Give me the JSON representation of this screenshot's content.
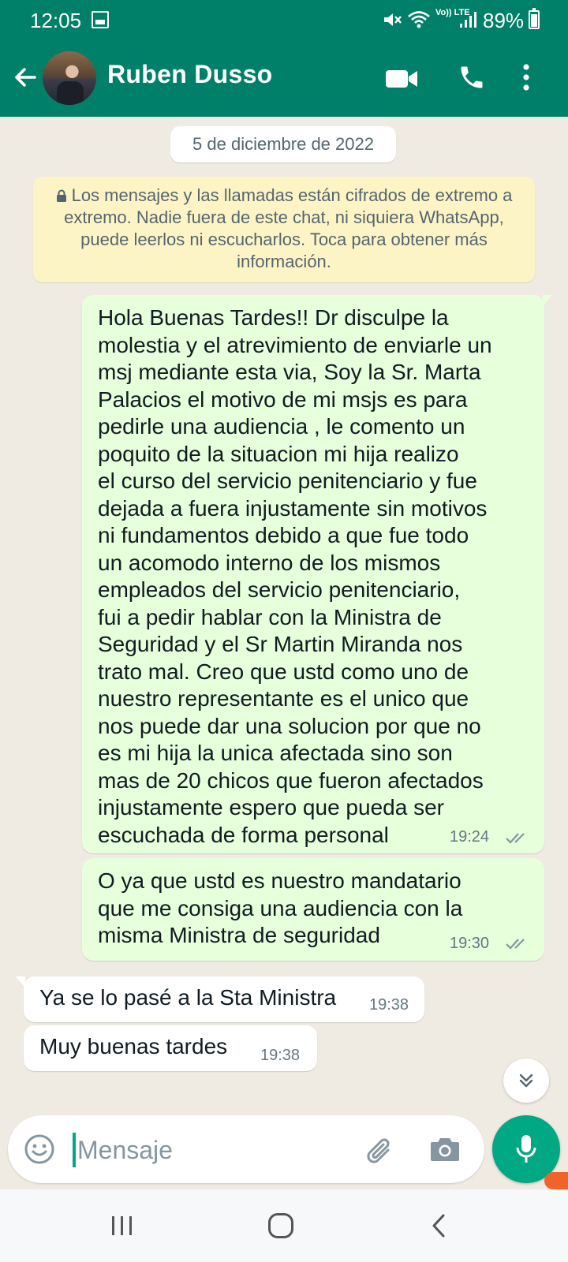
{
  "status_bar": {
    "time": "12:05",
    "network_label": "Vo)) LTE",
    "battery": "89%",
    "battery_level": 0.89
  },
  "header": {
    "contact_name": "Ruben Dusso",
    "back_icon": "arrow-left-icon",
    "video_icon": "video-camera-icon",
    "call_icon": "phone-icon",
    "menu_icon": "more-vert-icon"
  },
  "chat": {
    "date_chip": "5 de diciembre de 2022",
    "encryption_notice": "Los mensajes y las llamadas están cifrados de extremo a extremo. Nadie fuera de este chat, ni siquiera WhatsApp, puede leerlos ni escucharlos. Toca para obtener más información.",
    "messages": [
      {
        "direction": "outgoing",
        "text": "Hola Buenas Tardes!! Dr disculpe la\nmolestia y el atrevimiento de enviarle un\nmsj mediante esta via, Soy la Sr. Marta\nPalacios el motivo de mi msjs es para\npedirle una audiencia , le comento un\npoquito de la situacion mi hija realizo\nel curso del servicio penitenciario y fue\ndejada a fuera injustamente sin motivos\nni fundamentos debido a que fue todo\nun acomodo interno de los mismos\nempleados del servicio penitenciario,\nfui a pedir hablar con la Ministra de\nSeguridad  y el Sr Martin Miranda nos\ntrato mal. Creo que ustd como uno de\nnuestro representante es el unico que\nnos puede dar una solucion por que no\nes mi hija la unica afectada sino son\nmas de 20 chicos que fueron afectados\ninjustamente espero que pueda ser\nescuchada de forma personal",
        "time": "19:24",
        "status": "delivered"
      },
      {
        "direction": "outgoing",
        "text": "O ya que ustd es nuestro mandatario\nque me consiga una audiencia con la\nmisma  Ministra de seguridad",
        "time": "19:30",
        "status": "delivered"
      },
      {
        "direction": "incoming",
        "text": "Ya se lo pasé a la Sta Ministra",
        "time": "19:38"
      },
      {
        "direction": "incoming",
        "text": "Muy buenas tardes",
        "time": "19:38"
      }
    ]
  },
  "composer": {
    "placeholder": "Mensaje",
    "emoji_icon": "emoji-icon",
    "attach_icon": "paperclip-icon",
    "camera_icon": "camera-icon",
    "mic_icon": "microphone-icon"
  },
  "colors": {
    "brand": "#008069",
    "accent": "#00a884",
    "outgoing_bubble": "#e7ffdb",
    "incoming_bubble": "#ffffff",
    "notice": "#fdf4c5",
    "chat_background": "#efeae2"
  }
}
